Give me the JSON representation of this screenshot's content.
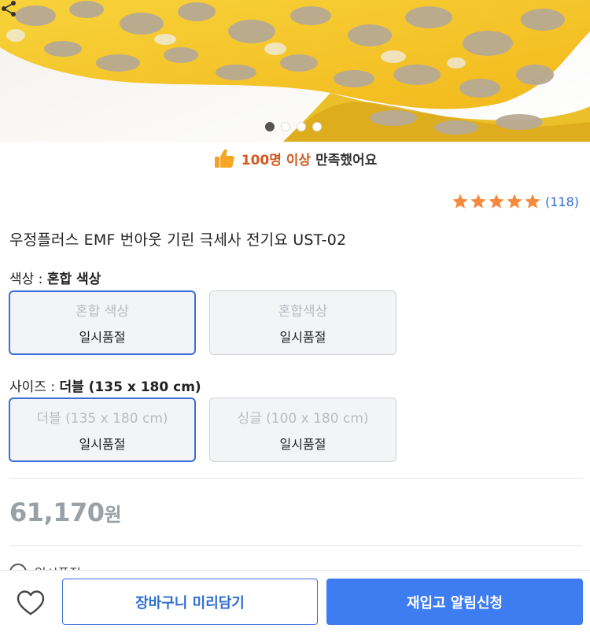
{
  "hero": {
    "slide_count": 4,
    "active_slide": 1
  },
  "satisfaction": {
    "highlight": "100명 이상",
    "text": "만족했어요"
  },
  "rating": {
    "stars": 5,
    "count": "(118)"
  },
  "product": {
    "title": "우정플러스 EMF 번아웃 기린 극세사 전기요 UST-02"
  },
  "options": {
    "color": {
      "label": "색상 : ",
      "selected": "혼합 색상",
      "choices": [
        {
          "name": "혼합 색상",
          "status": "일시품절"
        },
        {
          "name": "혼합색상",
          "status": "일시품절"
        }
      ]
    },
    "size": {
      "label": "사이즈 : ",
      "selected": "더블 (135 x 180 cm)",
      "choices": [
        {
          "name": "더블 (135 x 180 cm)",
          "status": "일시품절"
        },
        {
          "name": "싱글 (100 x 180 cm)",
          "status": "일시품절"
        }
      ]
    }
  },
  "price": {
    "amount": "61,170",
    "unit": "원"
  },
  "peek_text": "일시품절",
  "bottom_bar": {
    "cart_label": "장바구니 미리담기",
    "notify_label": "재입고 알림신청"
  },
  "colors": {
    "accent_blue": "#3d7cf1",
    "star_orange": "#f58a3c",
    "highlight_orange": "#d2591e"
  }
}
